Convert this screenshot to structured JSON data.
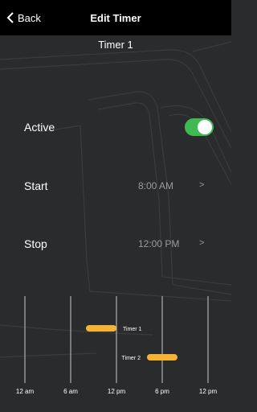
{
  "header": {
    "back_label": "Back",
    "title": "Edit Timer"
  },
  "timer": {
    "name": "Timer 1"
  },
  "active": {
    "label": "Active",
    "enabled": true
  },
  "start": {
    "label": "Start",
    "value": "8:00 AM"
  },
  "stop": {
    "label": "Stop",
    "value": "12:00 PM"
  },
  "colors": {
    "toggle_on": "#3fb950",
    "bar": "#f5b335",
    "background": "#2a2b2d"
  },
  "chart_data": {
    "type": "bar",
    "x_ticks": [
      "12 am",
      "6 am",
      "12 pm",
      "6 pm",
      "12 pm"
    ],
    "x_range_hours": [
      0,
      24
    ],
    "series": [
      {
        "name": "Timer 1",
        "start": 8,
        "end": 12
      },
      {
        "name": "Timer 2",
        "start": 16,
        "end": 20
      }
    ]
  }
}
